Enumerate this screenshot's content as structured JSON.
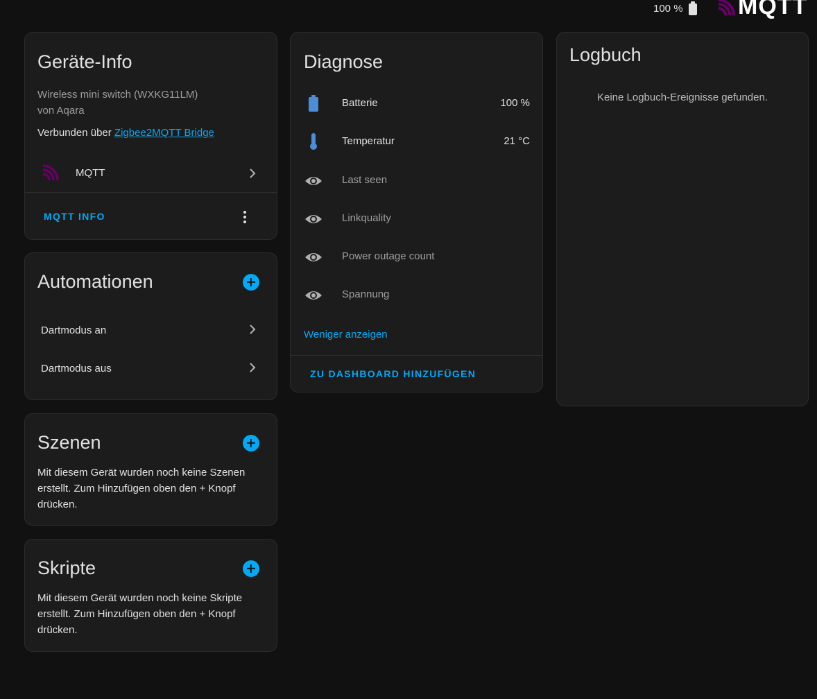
{
  "topbar": {
    "battery_text": "100 %",
    "logo_text": "MQTT"
  },
  "device_info": {
    "title": "Geräte-Info",
    "model": "Wireless mini switch (WXKG11LM)",
    "manufacturer": "von Aqara",
    "connected_prefix": "Verbunden über ",
    "connected_link": "Zigbee2MQTT Bridge",
    "integration_label": "MQTT",
    "mqtt_info_button": "MQTT INFO",
    "icons": {
      "integration": "mqtt-logo-icon",
      "menu": "more-vertical-icon"
    }
  },
  "automations": {
    "title": "Automationen",
    "items": [
      {
        "label": "Dartmodus an"
      },
      {
        "label": "Dartmodus aus"
      }
    ]
  },
  "scenes": {
    "title": "Szenen",
    "empty_text_1": "Mit diesem Gerät wurden noch keine Szenen",
    "empty_text_2": "erstellt. Zum Hinzufügen oben den + Knopf",
    "empty_text_3": "drücken."
  },
  "scripts": {
    "title": "Skripte",
    "empty_text_1": "Mit diesem Gerät wurden noch keine Skripte",
    "empty_text_2": "erstellt. Zum Hinzufügen oben den + Knopf",
    "empty_text_3": "drücken."
  },
  "diagnostics": {
    "title": "Diagnose",
    "rows": [
      {
        "label": "Batterie",
        "value": "100 %",
        "icon": "battery-icon"
      },
      {
        "label": "Temperatur",
        "value": "21 °C",
        "icon": "thermometer-icon"
      },
      {
        "label": "Last seen",
        "icon": "eye-icon"
      },
      {
        "label": "Linkquality",
        "icon": "eye-icon"
      },
      {
        "label": "Power outage count",
        "icon": "eye-icon"
      },
      {
        "label": "Spannung",
        "icon": "eye-icon"
      }
    ],
    "show_less": "Weniger anzeigen",
    "add_to_dashboard": "ZU DASHBOARD HINZUFÜGEN",
    "accent_color": "#4a8ed8"
  },
  "logbook": {
    "title": "Logbuch",
    "empty_text": "Keine Logbuch-Ereignisse gefunden."
  },
  "colors": {
    "accent": "#03a9f4",
    "background": "#111111",
    "card": "#1c1c1c",
    "mqtt_purple": "#660066"
  }
}
